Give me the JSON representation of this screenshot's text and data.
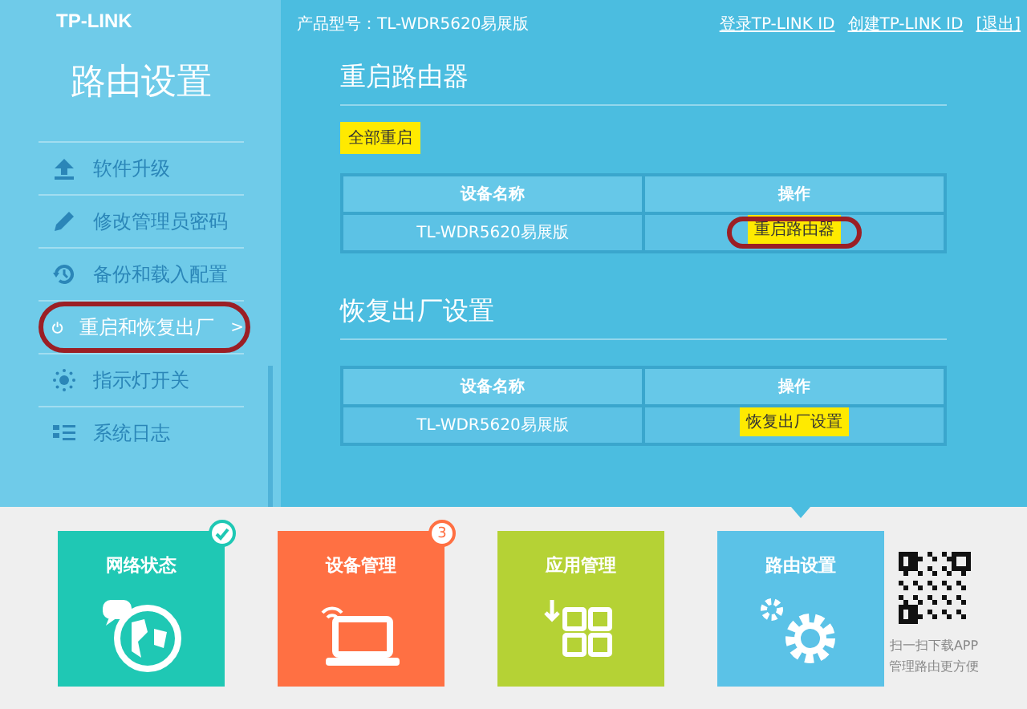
{
  "header": {
    "logo": "TP-LINK",
    "product": "产品型号：TL-WDR5620易展版",
    "links": [
      "登录TP-LINK ID",
      "创建TP-LINK ID",
      "[退出]"
    ]
  },
  "sidebar": {
    "title": "路由设置",
    "items": [
      {
        "label": "软件升级",
        "selected": false,
        "circled": false
      },
      {
        "label": "修改管理员密码",
        "selected": false,
        "circled": false
      },
      {
        "label": "备份和载入配置",
        "selected": false,
        "circled": false
      },
      {
        "label": "重启和恢复出厂",
        "selected": true,
        "circled": true,
        "arrow": ">"
      },
      {
        "label": "指示灯开关",
        "selected": false,
        "circled": false
      },
      {
        "label": "系统日志",
        "selected": false,
        "circled": false
      }
    ]
  },
  "sections": [
    {
      "title": "重启路由器",
      "top_button": "全部重启",
      "columns": [
        "设备名称",
        "操作"
      ],
      "rows": [
        {
          "device": "TL-WDR5620易展版",
          "action": "重启路由器",
          "circled": true
        }
      ]
    },
    {
      "title": "恢复出厂设置",
      "columns": [
        "设备名称",
        "操作"
      ],
      "rows": [
        {
          "device": "TL-WDR5620易展版",
          "action": "恢复出厂设置",
          "circled": false
        }
      ]
    }
  ],
  "tiles": [
    {
      "label": "网络状态",
      "color": "#1fc8b4",
      "checked": true,
      "selected": false
    },
    {
      "label": "设备管理",
      "color": "#ff7043",
      "checked": false,
      "badge": "3",
      "selected": false
    },
    {
      "label": "应用管理",
      "color": "#b5d235",
      "checked": false,
      "selected": false
    },
    {
      "label": "路由设置",
      "color": "#5bc2e7",
      "checked": false,
      "selected": true
    }
  ],
  "qr": {
    "lines": [
      "扫一扫下载APP",
      "管理路由更方便"
    ]
  }
}
